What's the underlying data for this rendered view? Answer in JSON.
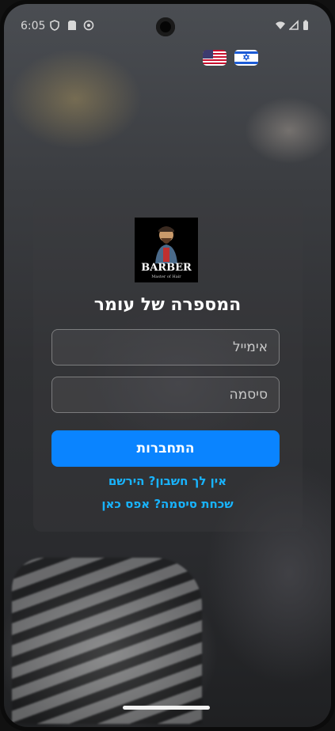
{
  "status_bar": {
    "time": "6:05"
  },
  "languages": [
    {
      "code": "en",
      "icon": "us-flag-icon"
    },
    {
      "code": "he",
      "icon": "israel-flag-icon"
    }
  ],
  "logo": {
    "text": "BARBER",
    "subtext": "Master of Hair"
  },
  "app_title": "המספרה של עומר",
  "form": {
    "email_placeholder": "אימייל",
    "password_placeholder": "סיסמה",
    "login_label": "התחברות"
  },
  "links": {
    "register": "אין לך חשבון? הירשם",
    "forgot_password": "שכחת סיסמה? אפס כאן"
  },
  "colors": {
    "accent": "#0a84ff",
    "link": "#18b4ff"
  }
}
